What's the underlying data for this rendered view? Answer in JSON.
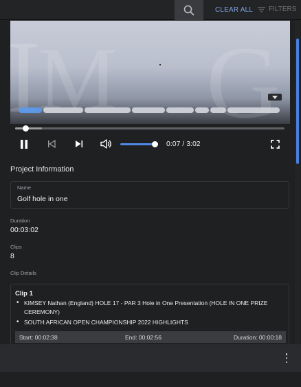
{
  "toolbar": {
    "search_icon": "search-icon",
    "clear_all_label": "CLEAR ALL",
    "filters_label": "FILTERS",
    "filters_icon": "filter-lines-icon",
    "accent_color": "#7ea3e6"
  },
  "player": {
    "quality_icon": "chevron-down-icon",
    "progress_fraction": 0.039,
    "buffered_fraction": 0.1,
    "volume_fraction": 1.0,
    "current_time": "0:07",
    "separator": " / ",
    "duration": "3:02",
    "play_state_icon": "pause-icon",
    "prev_icon": "skip-previous-icon",
    "next_icon": "skip-next-icon",
    "volume_icon": "volume-high-icon",
    "fullscreen_icon": "fullscreen-icon",
    "chapter_color": "#d5d8de",
    "active_chapter_color": "#5b9bf0"
  },
  "project": {
    "section_title": "Project Information",
    "name_label": "Name",
    "name_value": "Golf hole in one",
    "duration_label": "Duration",
    "duration_value": "00:03:02",
    "clips_label": "Clips",
    "clips_value": "8",
    "clip_details_label": "Clip Details"
  },
  "clips": [
    {
      "title": "Clip 1",
      "bullets": [
        "KIMSEY Nathan (England) HOLE 17 - PAR 3 Hole in One Presentation (HOLE IN ONE PRIZE CEREMONY)",
        "SOUTH AFRICAN OPEN CHAMPIONSHIP 2022 HIGHLIGHTS"
      ],
      "start": "Start: 00:02:38",
      "end": "End: 00:02:56",
      "duration": "Duration: 00:00:18"
    }
  ],
  "bottom_bar": {
    "menu_icon": "more-vertical-icon"
  }
}
